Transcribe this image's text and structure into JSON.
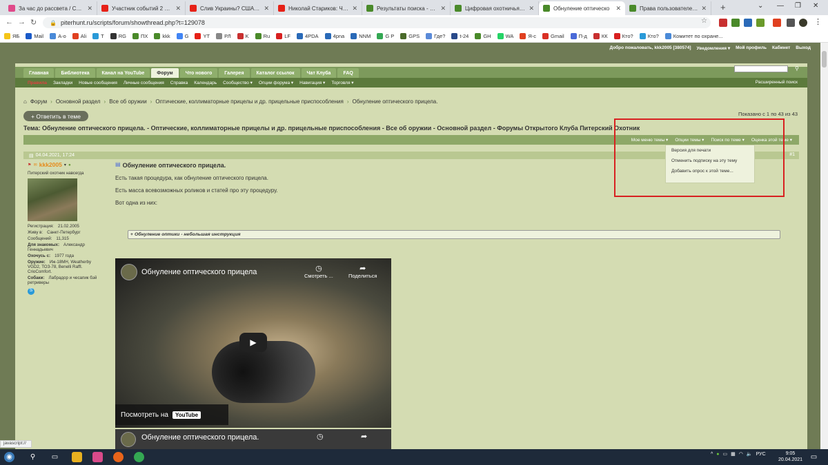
{
  "browser": {
    "tabs": [
      {
        "title": "За час до рассвета / Серд",
        "icon": "colorful-app-icon",
        "color": "#e04a8a"
      },
      {
        "title": "Участник событий 2 мая в",
        "icon": "youtube-icon",
        "color": "#e62117"
      },
      {
        "title": "Слив Украины? США подк",
        "icon": "youtube-icon",
        "color": "#e62117"
      },
      {
        "title": "Николай Стариков: Чехия",
        "icon": "youtube-icon",
        "color": "#e62117"
      },
      {
        "title": "Результаты поиска - Фору",
        "icon": "forum-icon",
        "color": "#4a8a2a"
      },
      {
        "title": "Цифровая охотничья нас",
        "icon": "forum-icon",
        "color": "#4a8a2a"
      },
      {
        "title": "Обнуление оптическо",
        "icon": "forum-icon",
        "color": "#4a8a2a",
        "active": true
      },
      {
        "title": "Права пользователей по",
        "icon": "forum-icon",
        "color": "#4a8a2a"
      }
    ],
    "url": "piterhunt.ru/scripts/forum/showthread.php?t=129078",
    "bookmarks": [
      {
        "label": "ЯБ",
        "color": "#f5c518"
      },
      {
        "label": "Mail",
        "color": "#1a5ac8"
      },
      {
        "label": "A-o",
        "color": "#4a8ad8"
      },
      {
        "label": "Ali",
        "color": "#e04020"
      },
      {
        "label": "T",
        "color": "#2a9ad8"
      },
      {
        "label": "RG",
        "color": "#333"
      },
      {
        "label": "ПХ",
        "color": "#4a8a2a"
      },
      {
        "label": "kkk",
        "color": "#4a8a2a"
      },
      {
        "label": "G",
        "color": "#4285f4"
      },
      {
        "label": "YT",
        "color": "#e62117"
      },
      {
        "label": "РЛ",
        "color": "#888"
      },
      {
        "label": "K",
        "color": "#c83030"
      },
      {
        "label": "Ru",
        "color": "#4a8a2a"
      },
      {
        "label": "LF",
        "color": "#d82020"
      },
      {
        "label": "4PDA",
        "color": "#2a6ab8"
      },
      {
        "label": "4pna",
        "color": "#2a6ab8"
      },
      {
        "label": "NNM",
        "color": "#2a6ab8"
      },
      {
        "label": "G P",
        "color": "#34a853"
      },
      {
        "label": "GPS",
        "color": "#4a6a2a"
      },
      {
        "label": "Где?",
        "color": "#5a8ad8"
      },
      {
        "label": "t-24",
        "color": "#2a4a8a"
      },
      {
        "label": "GH",
        "color": "#4a8a2a"
      },
      {
        "label": "WA",
        "color": "#25d366"
      },
      {
        "label": "Я-с",
        "color": "#e04020"
      },
      {
        "label": "Gmail",
        "color": "#d93025"
      },
      {
        "label": "П-д",
        "color": "#4a6ad8"
      },
      {
        "label": "КК",
        "color": "#c83030"
      },
      {
        "label": "Кто?",
        "color": "#d82020"
      },
      {
        "label": "Кто?",
        "color": "#2a9ad8"
      },
      {
        "label": "Комитет по охране...",
        "color": "#4a8ad8"
      }
    ]
  },
  "forum": {
    "topbar": [
      "Добро пожаловать, kkk2005 [380574]",
      "Уведомления ▾",
      "Мой профиль",
      "Кабинет",
      "Выход"
    ],
    "nav_tabs": [
      {
        "label": "Главная"
      },
      {
        "label": "Библиотека"
      },
      {
        "label": "Канал на YouTube"
      },
      {
        "label": "Форум",
        "active": true
      },
      {
        "label": "Что нового"
      },
      {
        "label": "Галерея"
      },
      {
        "label": "Каталог ссылок"
      },
      {
        "label": "Чат Клуба"
      },
      {
        "label": "FAQ"
      }
    ],
    "subnav": {
      "rules": "Правила",
      "items": [
        "Закладки",
        "Новые сообщения",
        "Личные сообщения",
        "Справка",
        "Календарь",
        "Сообщество ▾",
        "Опции форума ▾",
        "Навигация ▾",
        "Торговля ▾"
      ],
      "advanced_search": "Расширенный поиск"
    },
    "breadcrumb": [
      "Форум",
      "Основной раздел",
      "Все об оружии",
      "Оптические, коллиматорные прицелы и др. прицельные приспособления",
      "Обнуление оптического прицела."
    ],
    "reply_button": "+ Ответить в теме",
    "shown_count": "Показано с 1 по 43 из 43",
    "thread_title": "Тема: Обнуление оптического прицела. - Оптические, коллиматорные прицелы и др. прицельные приспособления - Все об оружии - Основной раздел - Форумы Открытого Клуба Питерский Охотник",
    "thread_tools": [
      "Мое меню темы ▾",
      "Опции темы ▾",
      "Поиск по теме ▾",
      "Оценка этой теме ▾"
    ],
    "dropdown": [
      "Версия для печати",
      "Отменить подписку на эту тему",
      "Добавить опрос к этой теме..."
    ],
    "post": {
      "date": "04.04.2021, 17:24",
      "number": "#1",
      "user": {
        "name": "kkk2005",
        "title": "Питерский охотник навсегда",
        "rows": [
          {
            "label": "Регистрация:",
            "value": "21.02.2005"
          },
          {
            "label": "Живу в:",
            "value": "Санкт-Петербург"
          },
          {
            "label": "Сообщений:",
            "value": "11,315"
          },
          {
            "label": "Для знакомых:",
            "value": "Александр Геннадьевич"
          },
          {
            "label": "Охочусь с:",
            "value": "1977 года"
          },
          {
            "label": "Оружие:",
            "value": "Иж-18МН, Weatherby VGD2, ТОЗ-78, Benelli Raffl. CrioComfort."
          },
          {
            "label": "Собаки:",
            "value": "Лабрадор и чесапик бэй ретриверы"
          }
        ]
      },
      "title": "Обнуление оптического прицела.",
      "paragraphs": [
        "Есть такая процедура, как обнуление оптического прицела.",
        "Есть масса всевозможных роликов и статей про эту процедуру.",
        "Вот одна из них:"
      ],
      "spoiler": "Обнуление оптики - небольшая инструкция",
      "video": {
        "title": "Обнуление оптического прицела",
        "watch_later": "Смотреть ...",
        "share": "Поделиться",
        "watch_on": "Посмотреть на",
        "yt": "YouTube"
      },
      "video2": {
        "title": "Обнуление оптического прицела."
      }
    }
  },
  "status_text": "javascript://",
  "taskbar": {
    "lang": "РУС",
    "time": "9:05",
    "date": "20.04.2021"
  }
}
